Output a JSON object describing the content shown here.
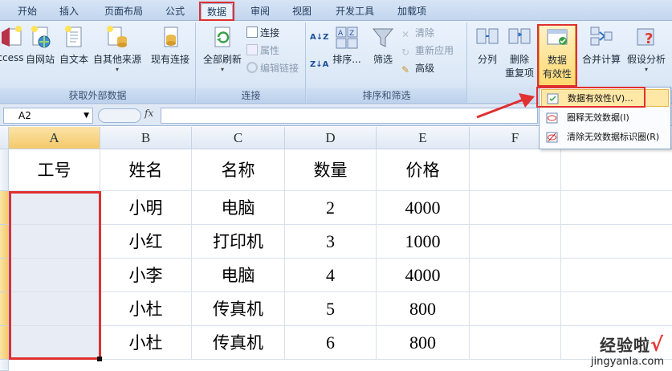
{
  "tabs": [
    {
      "label": "开始",
      "active": false
    },
    {
      "label": "插入",
      "active": false
    },
    {
      "label": "页面布局",
      "active": false
    },
    {
      "label": "公式",
      "active": false
    },
    {
      "label": "数据",
      "active": true
    },
    {
      "label": "审阅",
      "active": false
    },
    {
      "label": "视图",
      "active": false
    },
    {
      "label": "开发工具",
      "active": false
    },
    {
      "label": "加载项",
      "active": false
    }
  ],
  "ribbon": {
    "groups": {
      "external": "获取外部数据",
      "connections": "连接",
      "sort_filter": "排序和筛选"
    },
    "access": "ccess",
    "web": "自网站",
    "text": "自文本",
    "other": "自其他来源",
    "existing": "现有连接",
    "refresh_all": "全部刷新",
    "conn": "连接",
    "props": "属性",
    "edit_links": "编辑链接",
    "sort": "排序...",
    "filter": "筛选",
    "clear": "清除",
    "reapply": "重新应用",
    "advanced": "高级",
    "split": "分列",
    "remove_dup_1": "删除",
    "remove_dup_2": "重复项",
    "validation_1": "数据",
    "validation_2": "有效性",
    "consolidate": "合并计算",
    "whatif": "假设分析"
  },
  "formula_bar": {
    "name_box": "A2",
    "fx": "fx",
    "formula": ""
  },
  "grid": {
    "columns": [
      "A",
      "B",
      "C",
      "D",
      "E",
      "F"
    ],
    "headers": [
      "工号",
      "姓名",
      "名称",
      "数量",
      "价格"
    ],
    "rows": [
      [
        "",
        "小明",
        "电脑",
        "2",
        "4000"
      ],
      [
        "",
        "小红",
        "打印机",
        "3",
        "1000"
      ],
      [
        "",
        "小李",
        "电脑",
        "4",
        "4000"
      ],
      [
        "",
        "小杜",
        "传真机",
        "5",
        "800"
      ],
      [
        "",
        "小杜",
        "传真机",
        "6",
        "800"
      ]
    ]
  },
  "dropdown": {
    "items": [
      "数据有效性(V)...",
      "圈释无效数据(I)",
      "清除无效数据标识圈(R)"
    ]
  },
  "watermark": {
    "line1": "经验啦",
    "check": "√",
    "line2": "jingyanla.com"
  },
  "colors": {
    "accent_red": "#e03030",
    "selection_header": "#f4c96a"
  }
}
